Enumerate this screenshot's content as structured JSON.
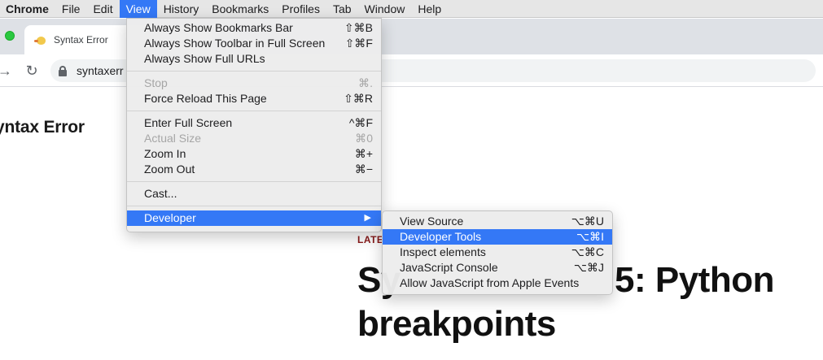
{
  "menubar": {
    "items": [
      "Chrome",
      "File",
      "Edit",
      "View",
      "History",
      "Bookmarks",
      "Profiles",
      "Tab",
      "Window",
      "Help"
    ]
  },
  "tab": {
    "title": "Syntax Error",
    "favicon": "duck-icon"
  },
  "toolbar": {
    "url": "syntaxerr"
  },
  "page": {
    "site_title": "yntax Error",
    "latest_label": "LATE",
    "post_title_line1": "Sy",
    "post_title_line1_end": "5: Python",
    "post_title_line2": "breakpoints"
  },
  "view_menu": {
    "items": [
      {
        "label": "Always Show Bookmarks Bar",
        "shortcut": "⇧⌘B",
        "disabled": false
      },
      {
        "label": "Always Show Toolbar in Full Screen",
        "shortcut": "⇧⌘F",
        "disabled": false
      },
      {
        "label": "Always Show Full URLs",
        "shortcut": "",
        "disabled": false
      },
      {
        "label": "Stop",
        "shortcut": "⌘.",
        "disabled": true
      },
      {
        "label": "Force Reload This Page",
        "shortcut": "⇧⌘R",
        "disabled": false
      },
      {
        "label": "Enter Full Screen",
        "shortcut": "^⌘F",
        "disabled": false
      },
      {
        "label": "Actual Size",
        "shortcut": "⌘0",
        "disabled": true
      },
      {
        "label": "Zoom In",
        "shortcut": "⌘+",
        "disabled": false
      },
      {
        "label": "Zoom Out",
        "shortcut": "⌘−",
        "disabled": false
      },
      {
        "label": "Cast...",
        "shortcut": "",
        "disabled": false
      },
      {
        "label": "Developer",
        "shortcut": "",
        "disabled": false,
        "highlighted": true
      }
    ]
  },
  "developer_menu": {
    "items": [
      {
        "label": "View Source",
        "shortcut": "⌥⌘U"
      },
      {
        "label": "Developer Tools",
        "shortcut": "⌥⌘I",
        "highlighted": true
      },
      {
        "label": "Inspect elements",
        "shortcut": "⌥⌘C"
      },
      {
        "label": "JavaScript Console",
        "shortcut": "⌥⌘J"
      },
      {
        "label": "Allow JavaScript from Apple Events",
        "shortcut": ""
      }
    ]
  },
  "colors": {
    "highlight": "#3478f6",
    "latest": "#8b1a1a"
  }
}
